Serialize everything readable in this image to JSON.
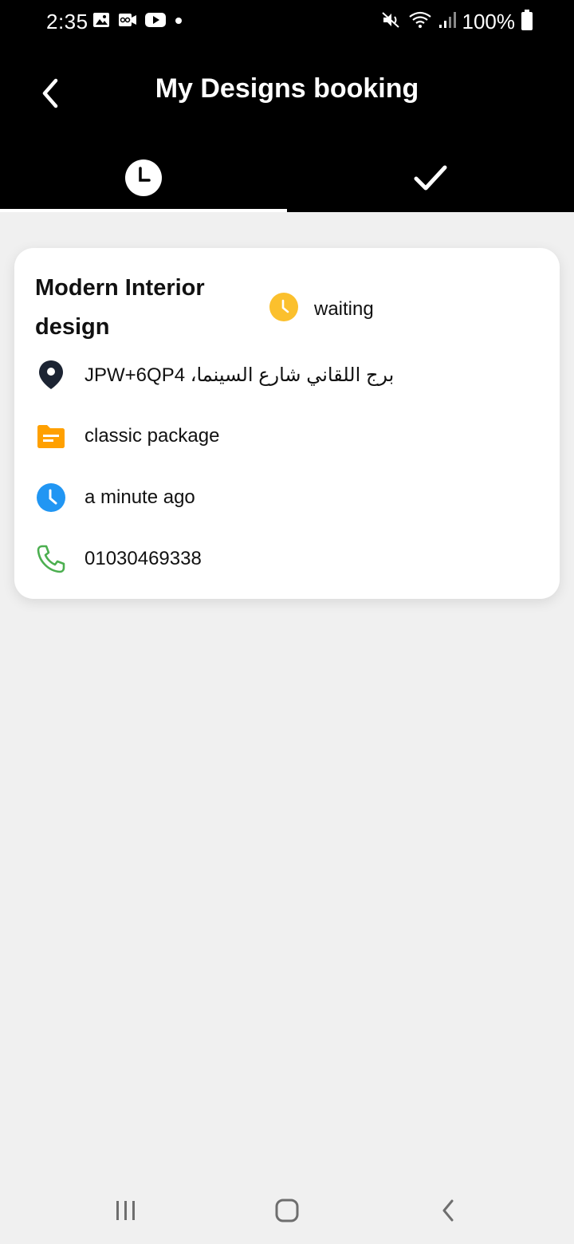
{
  "status_bar": {
    "time": "2:35",
    "battery": "100%",
    "icons": [
      "image-icon",
      "voicemail-icon",
      "youtube-icon",
      "dot-icon",
      "mute-icon",
      "wifi-icon",
      "signal-icon",
      "battery-icon"
    ]
  },
  "app_bar": {
    "title": "My Designs booking",
    "tabs": [
      {
        "icon": "clock-icon",
        "selected": true
      },
      {
        "icon": "check-icon",
        "selected": false
      }
    ]
  },
  "booking": {
    "title": "Modern Interior design",
    "status": "waiting",
    "address": "JPW+6QPبرج اللقاني شارع السينما، 4",
    "package": "classic package",
    "time_ago": "a minute ago",
    "phone": "01030469338"
  },
  "colors": {
    "header_bg": "#000000",
    "page_bg": "#f0f0f0",
    "status_yellow": "#fbc02d",
    "package_orange": "#ffa000",
    "time_blue": "#2196f3",
    "phone_green": "#4caf50"
  },
  "nav_bar": {
    "buttons": [
      "recent-apps-button",
      "home-button",
      "back-button"
    ]
  }
}
